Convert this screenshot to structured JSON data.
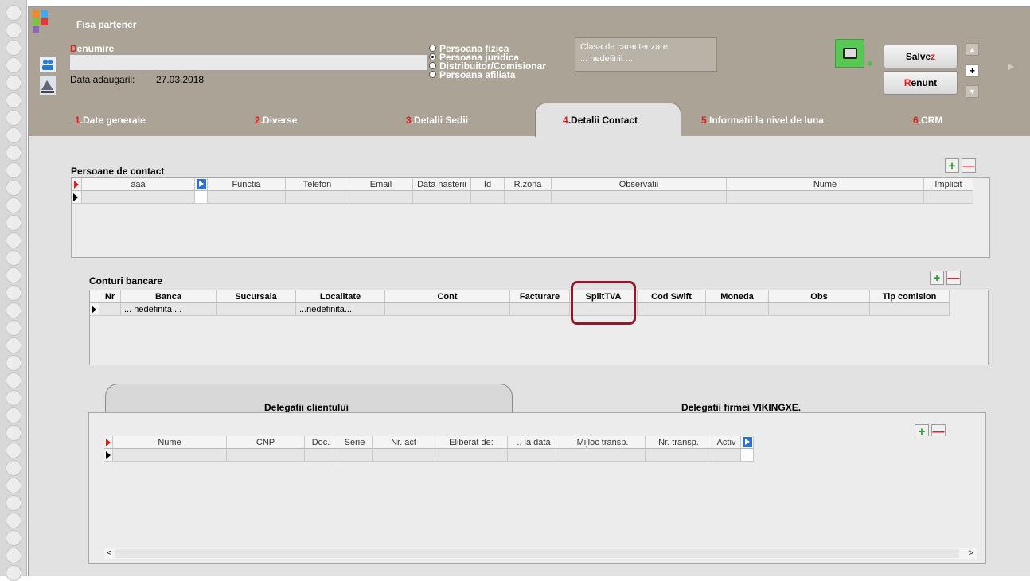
{
  "window": {
    "title": "Fisa partener"
  },
  "partner": {
    "name_label_first": "D",
    "name_label_rest": "enumire",
    "name_value": "",
    "date_label": "Data adaugarii:",
    "date_value": "27.03.2018"
  },
  "partner_type": {
    "options": [
      "Persoana fizica",
      "Persoana juridica",
      "Distribuitor/Comisionar",
      "Persoana afiliata"
    ],
    "selected": "Persoana juridica"
  },
  "clasa": {
    "label": "Clasa de caracterizare",
    "value": "... nedefinit ..."
  },
  "actions": {
    "save_pre": "Salve",
    "save_hot": "z",
    "cancel_hot": "R",
    "cancel_post": "enunt",
    "plus_label": "+"
  },
  "tabs": [
    {
      "num": "1",
      "label": ".Date generale"
    },
    {
      "num": "2",
      "label": ".Diverse"
    },
    {
      "num": "3",
      "label": ".Detalii Sedii"
    },
    {
      "num": "4",
      "label": ".Detalii Contact"
    },
    {
      "num": "5",
      "label": ".Informatii la nivel de luna"
    },
    {
      "num": "6",
      "label": ".CRM"
    }
  ],
  "contacts": {
    "title": "Persoane de contact",
    "columns": [
      "aaa",
      "Functia",
      "Telefon",
      "Email",
      "Data nasterii",
      "Id",
      "R.zona",
      "Observatii",
      "Nume",
      "Implicit"
    ]
  },
  "bank_accounts": {
    "title": "Conturi bancare",
    "columns": [
      "Nr",
      "Banca",
      "Sucursala",
      "Localitate",
      "Cont",
      "Facturare",
      "SplitTVA",
      "Cod Swift",
      "Moneda",
      "Obs",
      "Tip comision"
    ],
    "rows": [
      {
        "banca": "... nedefinita ...",
        "localitate": "...nedefinita..."
      }
    ]
  },
  "delegations": {
    "tabs": [
      "Delegatii clientului",
      "Delegatii firmei VIKINGXE."
    ],
    "columns": [
      "Nume",
      "CNP",
      "Doc.",
      "Serie",
      "Nr. act",
      "Eliberat de:",
      ".. la data",
      "Mijloc transp.",
      "Nr. transp.",
      "Activ"
    ]
  },
  "icons": {
    "plus": "+",
    "minus": "—",
    "scroll_left": "<",
    "scroll_right": ">",
    "up": "▲",
    "down": "▼",
    "far_right": "▶"
  },
  "colors": {
    "header_bg": "#aaa396",
    "hotkey_red": "#e41b17",
    "nav_blue": "#2f6fd6",
    "highlight_border": "#8b1a2c",
    "folder_green": "#58c855"
  }
}
